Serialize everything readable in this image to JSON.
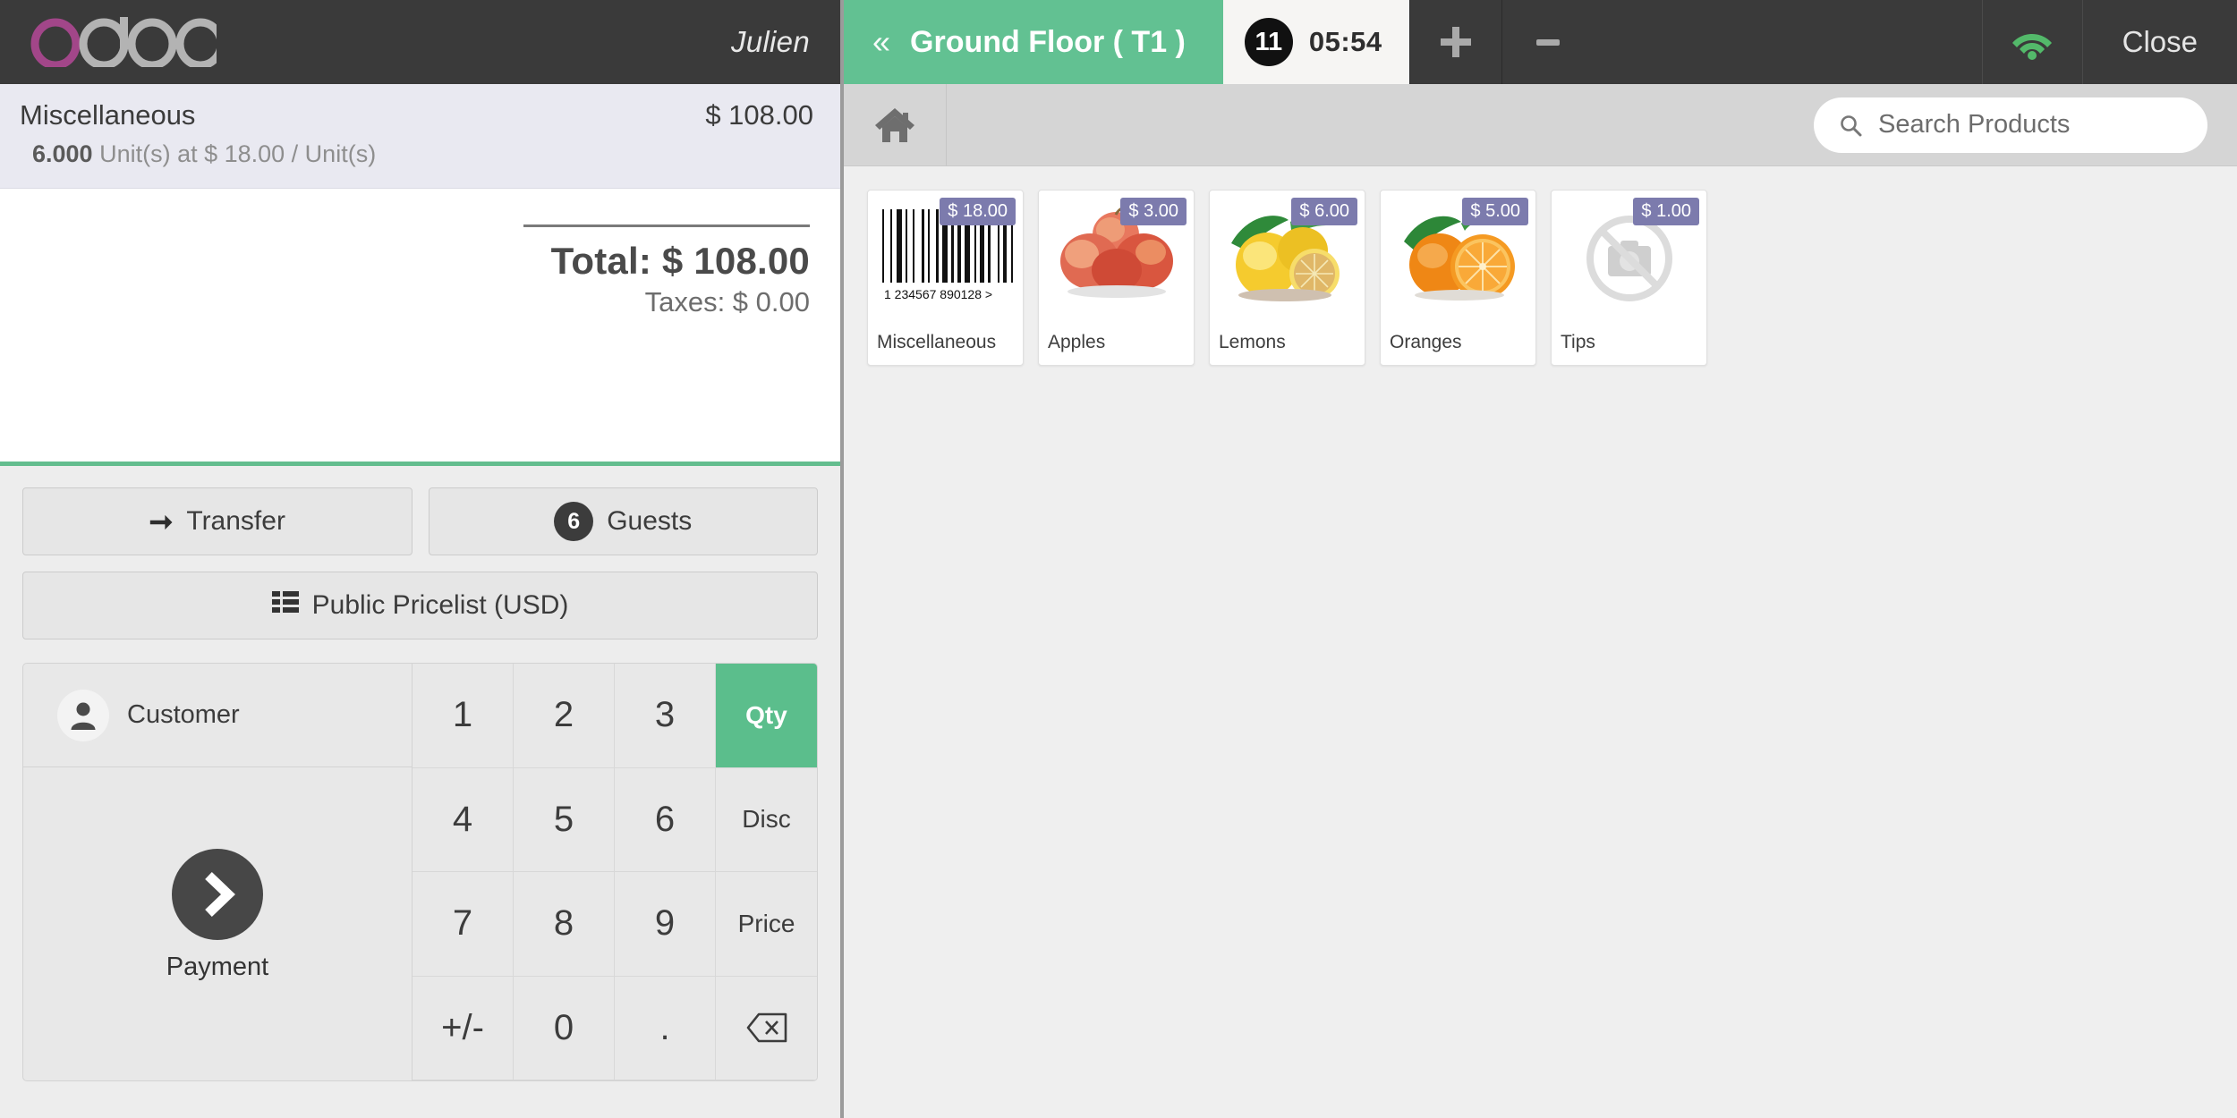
{
  "header": {
    "logo_text": "odoo",
    "logo_accent_color": "#a24689",
    "cashier_name": "Julien"
  },
  "topbar": {
    "floor_tab": {
      "back_icon": "chevron-double-left-icon",
      "label": "Ground Floor ( T1 )",
      "color": "#62c192"
    },
    "order_tab": {
      "badge_count": "11",
      "timer": "05:54"
    },
    "add_label": "+",
    "remove_label": "−",
    "wifi_icon": "wifi-icon",
    "wifi_color": "#53b96a",
    "close_label": "Close"
  },
  "order": {
    "lines": [
      {
        "name": "Miscellaneous",
        "price": "$ 108.00",
        "qty": "6.000",
        "detail": " Unit(s) at $ 18.00 / Unit(s)"
      }
    ],
    "total_label": "Total: $ 108.00",
    "taxes_label": "Taxes: $ 0.00"
  },
  "actions": {
    "transfer_label": "Transfer",
    "transfer_icon": "arrow-right-icon",
    "guests_count": "6",
    "guests_label": "Guests",
    "pricelist_label": "Public Pricelist (USD)",
    "pricelist_icon": "list-icon"
  },
  "numpad": {
    "customer_label": "Customer",
    "customer_icon": "user-icon",
    "payment_label": "Payment",
    "payment_icon": "chevron-right-icon",
    "keys": [
      {
        "label": "1",
        "mode": false,
        "active": false
      },
      {
        "label": "2",
        "mode": false,
        "active": false
      },
      {
        "label": "3",
        "mode": false,
        "active": false
      },
      {
        "label": "Qty",
        "mode": true,
        "active": true
      },
      {
        "label": "4",
        "mode": false,
        "active": false
      },
      {
        "label": "5",
        "mode": false,
        "active": false
      },
      {
        "label": "6",
        "mode": false,
        "active": false
      },
      {
        "label": "Disc",
        "mode": true,
        "active": false
      },
      {
        "label": "7",
        "mode": false,
        "active": false
      },
      {
        "label": "8",
        "mode": false,
        "active": false
      },
      {
        "label": "9",
        "mode": false,
        "active": false
      },
      {
        "label": "Price",
        "mode": true,
        "active": false
      },
      {
        "label": "+/-",
        "mode": false,
        "active": false
      },
      {
        "label": "0",
        "mode": false,
        "active": false
      },
      {
        "label": ".",
        "mode": false,
        "active": false
      },
      {
        "label": "",
        "mode": false,
        "active": false,
        "icon": "backspace-icon"
      }
    ]
  },
  "subbar": {
    "home_icon": "home-icon",
    "search_icon": "search-icon",
    "search_placeholder": "Search Products",
    "search_value": ""
  },
  "products": [
    {
      "name": "Miscellaneous",
      "price": "$ 18.00",
      "image": "barcode",
      "barcode_digits": "1  234567  890128  >"
    },
    {
      "name": "Apples",
      "price": "$ 3.00",
      "image": "apples"
    },
    {
      "name": "Lemons",
      "price": "$ 6.00",
      "image": "lemons"
    },
    {
      "name": "Oranges",
      "price": "$ 5.00",
      "image": "oranges"
    },
    {
      "name": "Tips",
      "price": "$ 1.00",
      "image": "no-image"
    }
  ],
  "colors": {
    "accent_green": "#62c192",
    "badge_purple": "#7c7bad",
    "dark_bar": "#3a3a3a"
  }
}
